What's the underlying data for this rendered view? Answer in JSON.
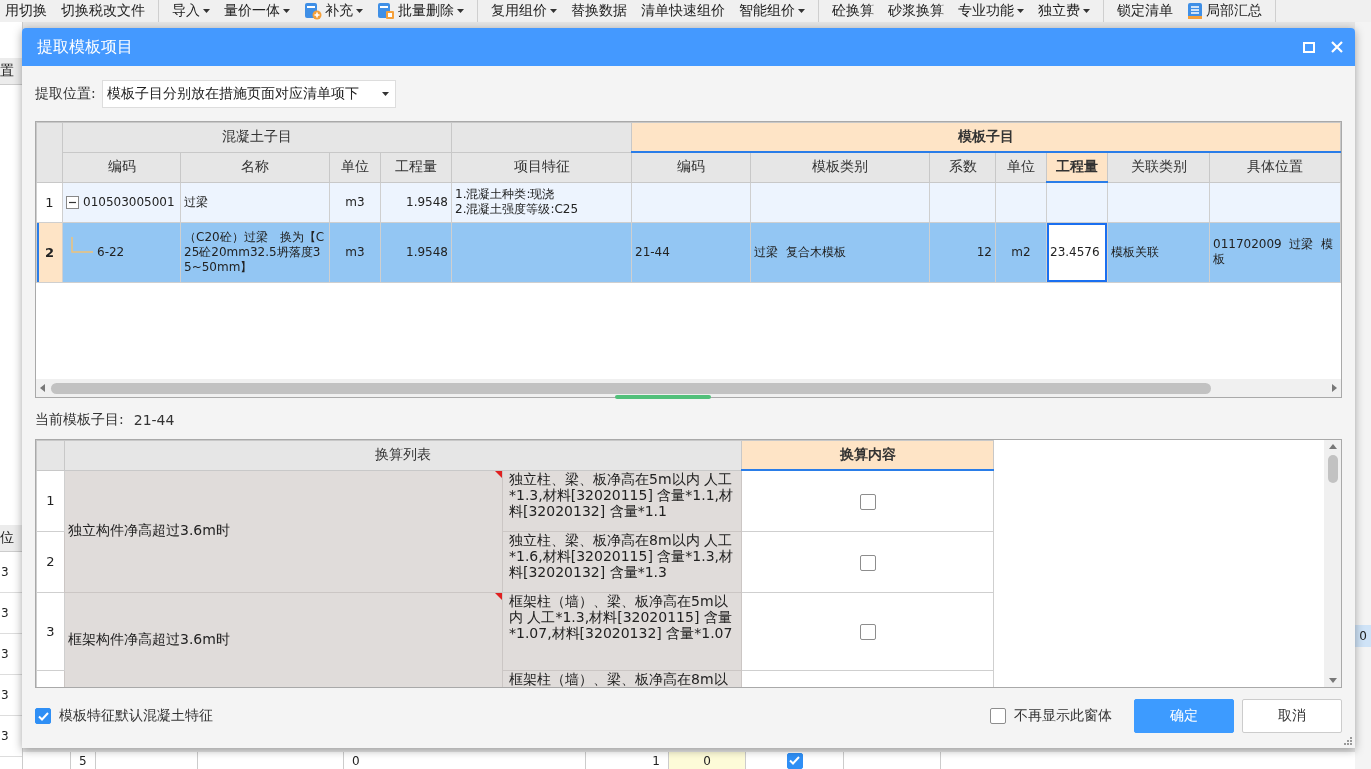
{
  "toolbar": [
    {
      "items": [
        {
          "label": "用切换",
          "kind": "plain",
          "dropdown": false
        },
        {
          "label": "切换税改文件",
          "kind": "plain",
          "dropdown": false
        }
      ]
    },
    {
      "items": [
        {
          "label": "导入",
          "kind": "plain",
          "dropdown": true
        },
        {
          "label": "量价一体",
          "kind": "plain",
          "dropdown": true
        },
        {
          "label": "补充",
          "kind": "add",
          "dropdown": true
        },
        {
          "label": "批量删除",
          "kind": "remove",
          "dropdown": true
        }
      ]
    },
    {
      "items": [
        {
          "label": "复用组价",
          "kind": "plain",
          "dropdown": true
        },
        {
          "label": "替换数据",
          "kind": "plain",
          "dropdown": false
        },
        {
          "label": "清单快速组价",
          "kind": "plain",
          "dropdown": false
        },
        {
          "label": "智能组价",
          "kind": "plain",
          "dropdown": true
        }
      ]
    },
    {
      "items": [
        {
          "label": "砼换算",
          "kind": "plain",
          "dropdown": false
        },
        {
          "label": "砂浆换算",
          "kind": "plain",
          "dropdown": false
        },
        {
          "label": "专业功能",
          "kind": "plain",
          "dropdown": true
        },
        {
          "label": "独立费",
          "kind": "plain",
          "dropdown": true
        }
      ]
    },
    {
      "items": [
        {
          "label": "锁定清单",
          "kind": "plain",
          "dropdown": false
        },
        {
          "label": "局部汇总",
          "kind": "summary",
          "dropdown": false
        }
      ]
    }
  ],
  "background": {
    "left_column": {
      "top_heading": "置",
      "heading": "位",
      "cells": [
        "3",
        "3",
        "3",
        "3",
        "3"
      ]
    },
    "bottom_row": {
      "cells": [
        "5",
        null,
        null,
        "0",
        "1",
        "0"
      ],
      "checked": true
    },
    "right_column": {
      "cells": [
        "0"
      ]
    }
  },
  "dialog": {
    "title": "提取模板项目",
    "location": {
      "label": "提取位置:",
      "value": "模板子目分别放在措施页面对应清单项下"
    },
    "upper_table": {
      "column_groups": [
        {
          "label": "混凝土子目",
          "highlight": false,
          "columns": [
            {
              "label": "编码",
              "selected": false
            },
            {
              "label": "名称",
              "selected": false
            },
            {
              "label": "单位",
              "selected": false
            },
            {
              "label": "工程量",
              "selected": false
            }
          ]
        },
        {
          "highlight": false,
          "columns": [
            {
              "label": "项目特征",
              "selected": false
            }
          ]
        },
        {
          "label": "模板子目",
          "highlight": true,
          "columns": [
            {
              "label": "编码",
              "selected": false
            },
            {
              "label": "模板类别",
              "selected": false
            },
            {
              "label": "系数",
              "selected": false
            },
            {
              "label": "单位",
              "selected": false
            },
            {
              "label": "工程量",
              "selected": true
            },
            {
              "label": "关联类别",
              "selected": false
            },
            {
              "label": "具体位置",
              "selected": false
            }
          ]
        }
      ],
      "rows": [
        {
          "number": "1",
          "selected": false,
          "expanded": true,
          "cells": [
            "010503005001",
            "过梁",
            "m3",
            "1.9548",
            "1.混凝土种类:现浇\n2.混凝土强度等级:C25",
            null,
            null,
            null,
            null,
            null,
            null,
            null
          ],
          "children": [
            {
              "number": "2",
              "selected": true,
              "cells": [
                "6-22",
                "（C20砼）过梁　换为【C25砼20mm32.5坍落度35~50mm】",
                "m3",
                "1.9548",
                null,
                "21-44",
                "过梁  复合木模板",
                "12",
                "m2",
                "23.4576",
                "模板关联",
                "011702009  过梁  模板"
              ]
            }
          ]
        }
      ]
    },
    "current_template": {
      "label": "当前模板子目:",
      "value": "21-44"
    },
    "conversion_table": {
      "columns": [
        {
          "label": "换算列表",
          "selected": false
        },
        {
          "label": "换算内容",
          "selected": true
        }
      ],
      "groups": [
        {
          "label": "独立构件净高超过3.6m时",
          "items": [
            {
              "number": "1",
              "text": "独立柱、梁、板净高在5m以内 人工*1.3,材料[32020115] 含量*1.1,材料[32020132] 含量*1.1",
              "checked": false
            },
            {
              "number": "2",
              "text": "独立柱、梁、板净高在8m以内 人工*1.6,材料[32020115] 含量*1.3,材料[32020132] 含量*1.3",
              "checked": false
            }
          ]
        },
        {
          "label": "框架构件净高超过3.6m时",
          "items": [
            {
              "number": "3",
              "text": "框架柱（墙）、梁、板净高在5m以内 人工*1.3,材料[32020115] 含量*1.07,材料[32020132] 含量*1.07",
              "checked": false
            },
            {
              "text": "框架柱（墙）、梁、板净高在8m以"
            }
          ]
        }
      ]
    },
    "footer": {
      "default_feature": {
        "label": "模板特征默认混凝土特征",
        "checked": true
      },
      "hide_window": {
        "label": "不再显示此窗体",
        "checked": false
      },
      "buttons": [
        {
          "label": "确定",
          "kind": "primary"
        },
        {
          "label": "取消",
          "kind": "secondary"
        }
      ]
    }
  }
}
